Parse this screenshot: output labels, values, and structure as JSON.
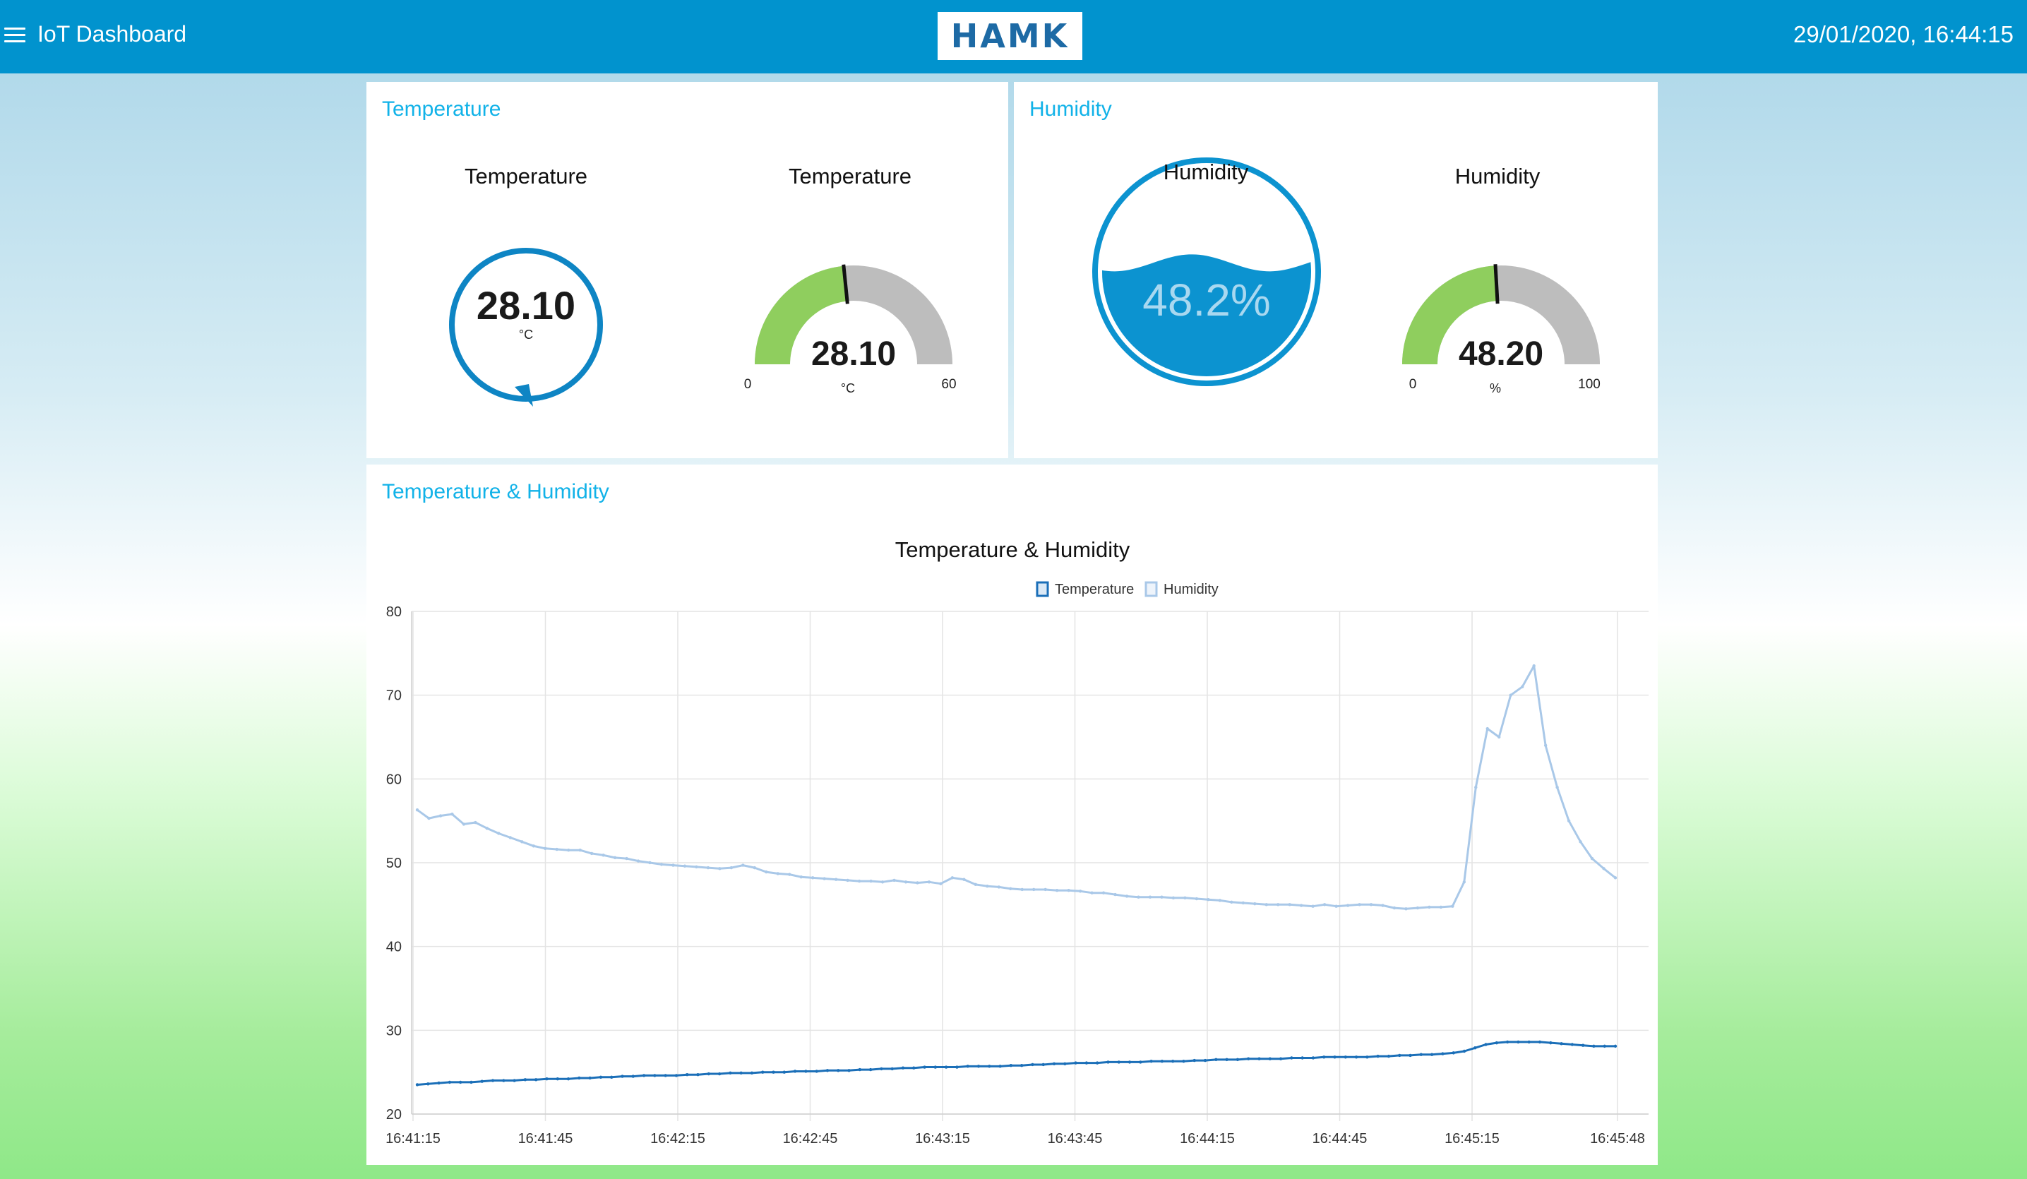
{
  "header": {
    "menu_icon": "hamburger-menu-icon",
    "title": "IoT Dashboard",
    "logo_text": "HAMK",
    "datetime": "29/01/2020, 16:44:15",
    "color": "#0193ce"
  },
  "temperature_card": {
    "title": "Temperature",
    "donut": {
      "label": "Temperature",
      "value": "28.10",
      "unit": "°C",
      "color": "#0e85c4"
    },
    "gauge": {
      "label": "Temperature",
      "value": "28.10",
      "unit": "°C",
      "min": "0",
      "max": "60",
      "level": 0.468
    }
  },
  "humidity_card": {
    "title": "Humidity",
    "level_widget": {
      "label": "Humidity",
      "value": "48.2%",
      "fill_level": 0.482,
      "color": "#0c93d0"
    },
    "gauge": {
      "label": "Humidity",
      "value": "48.20",
      "unit": "%",
      "min": "0",
      "max": "100",
      "level": 0.482
    }
  },
  "chart_card": {
    "title": "Temperature & Humidity"
  },
  "chart_data": {
    "type": "line",
    "title": "Temperature & Humidity",
    "legend": [
      "Temperature",
      "Humidity"
    ],
    "legend_position": "top",
    "ylim": [
      20,
      80
    ],
    "yticks": [
      "20",
      "30",
      "40",
      "50",
      "60",
      "70",
      "80"
    ],
    "xticks": [
      "16:41:15",
      "16:41:45",
      "16:42:15",
      "16:42:45",
      "16:43:15",
      "16:43:45",
      "16:44:15",
      "16:44:45",
      "16:45:15",
      "16:45:48"
    ],
    "grid": true,
    "series": [
      {
        "name": "Temperature",
        "color": "#1b6fb8",
        "values": [
          23.5,
          23.6,
          23.7,
          23.8,
          23.8,
          23.8,
          23.9,
          24.0,
          24.0,
          24.0,
          24.1,
          24.1,
          24.2,
          24.2,
          24.2,
          24.3,
          24.3,
          24.4,
          24.4,
          24.5,
          24.5,
          24.6,
          24.6,
          24.6,
          24.6,
          24.7,
          24.7,
          24.8,
          24.8,
          24.9,
          24.9,
          24.9,
          25.0,
          25.0,
          25.0,
          25.1,
          25.1,
          25.1,
          25.2,
          25.2,
          25.2,
          25.3,
          25.3,
          25.4,
          25.4,
          25.5,
          25.5,
          25.6,
          25.6,
          25.6,
          25.6,
          25.7,
          25.7,
          25.7,
          25.7,
          25.8,
          25.8,
          25.9,
          25.9,
          26.0,
          26.0,
          26.1,
          26.1,
          26.1,
          26.2,
          26.2,
          26.2,
          26.2,
          26.3,
          26.3,
          26.3,
          26.3,
          26.4,
          26.4,
          26.5,
          26.5,
          26.5,
          26.6,
          26.6,
          26.6,
          26.6,
          26.7,
          26.7,
          26.7,
          26.8,
          26.8,
          26.8,
          26.8,
          26.8,
          26.9,
          26.9,
          27.0,
          27.0,
          27.1,
          27.1,
          27.2,
          27.3,
          27.5,
          27.9,
          28.3,
          28.5,
          28.6,
          28.6,
          28.6,
          28.6,
          28.5,
          28.4,
          28.3,
          28.2,
          28.1,
          28.1,
          28.1
        ]
      },
      {
        "name": "Humidity",
        "color": "#a9c8e8",
        "values": [
          56.3,
          55.3,
          55.6,
          55.8,
          54.6,
          54.8,
          54.1,
          53.5,
          53.0,
          52.5,
          52.0,
          51.7,
          51.6,
          51.5,
          51.5,
          51.1,
          50.9,
          50.6,
          50.5,
          50.2,
          50.0,
          49.8,
          49.7,
          49.6,
          49.5,
          49.4,
          49.3,
          49.4,
          49.7,
          49.4,
          48.9,
          48.7,
          48.6,
          48.3,
          48.2,
          48.1,
          48.0,
          47.9,
          47.8,
          47.8,
          47.7,
          47.9,
          47.7,
          47.6,
          47.7,
          47.5,
          48.2,
          48.0,
          47.4,
          47.2,
          47.1,
          46.9,
          46.8,
          46.8,
          46.8,
          46.7,
          46.7,
          46.6,
          46.4,
          46.4,
          46.2,
          46.0,
          45.9,
          45.9,
          45.9,
          45.8,
          45.8,
          45.7,
          45.6,
          45.5,
          45.3,
          45.2,
          45.1,
          45.0,
          45.0,
          45.0,
          44.9,
          44.8,
          45.0,
          44.8,
          44.9,
          45.0,
          45.0,
          44.9,
          44.6,
          44.5,
          44.6,
          44.7,
          44.7,
          44.8,
          47.7,
          59.0,
          66.0,
          65.0,
          70.0,
          71.0,
          73.5,
          64.0,
          59.0,
          55.0,
          52.5,
          50.5,
          49.3,
          48.2
        ]
      }
    ]
  }
}
